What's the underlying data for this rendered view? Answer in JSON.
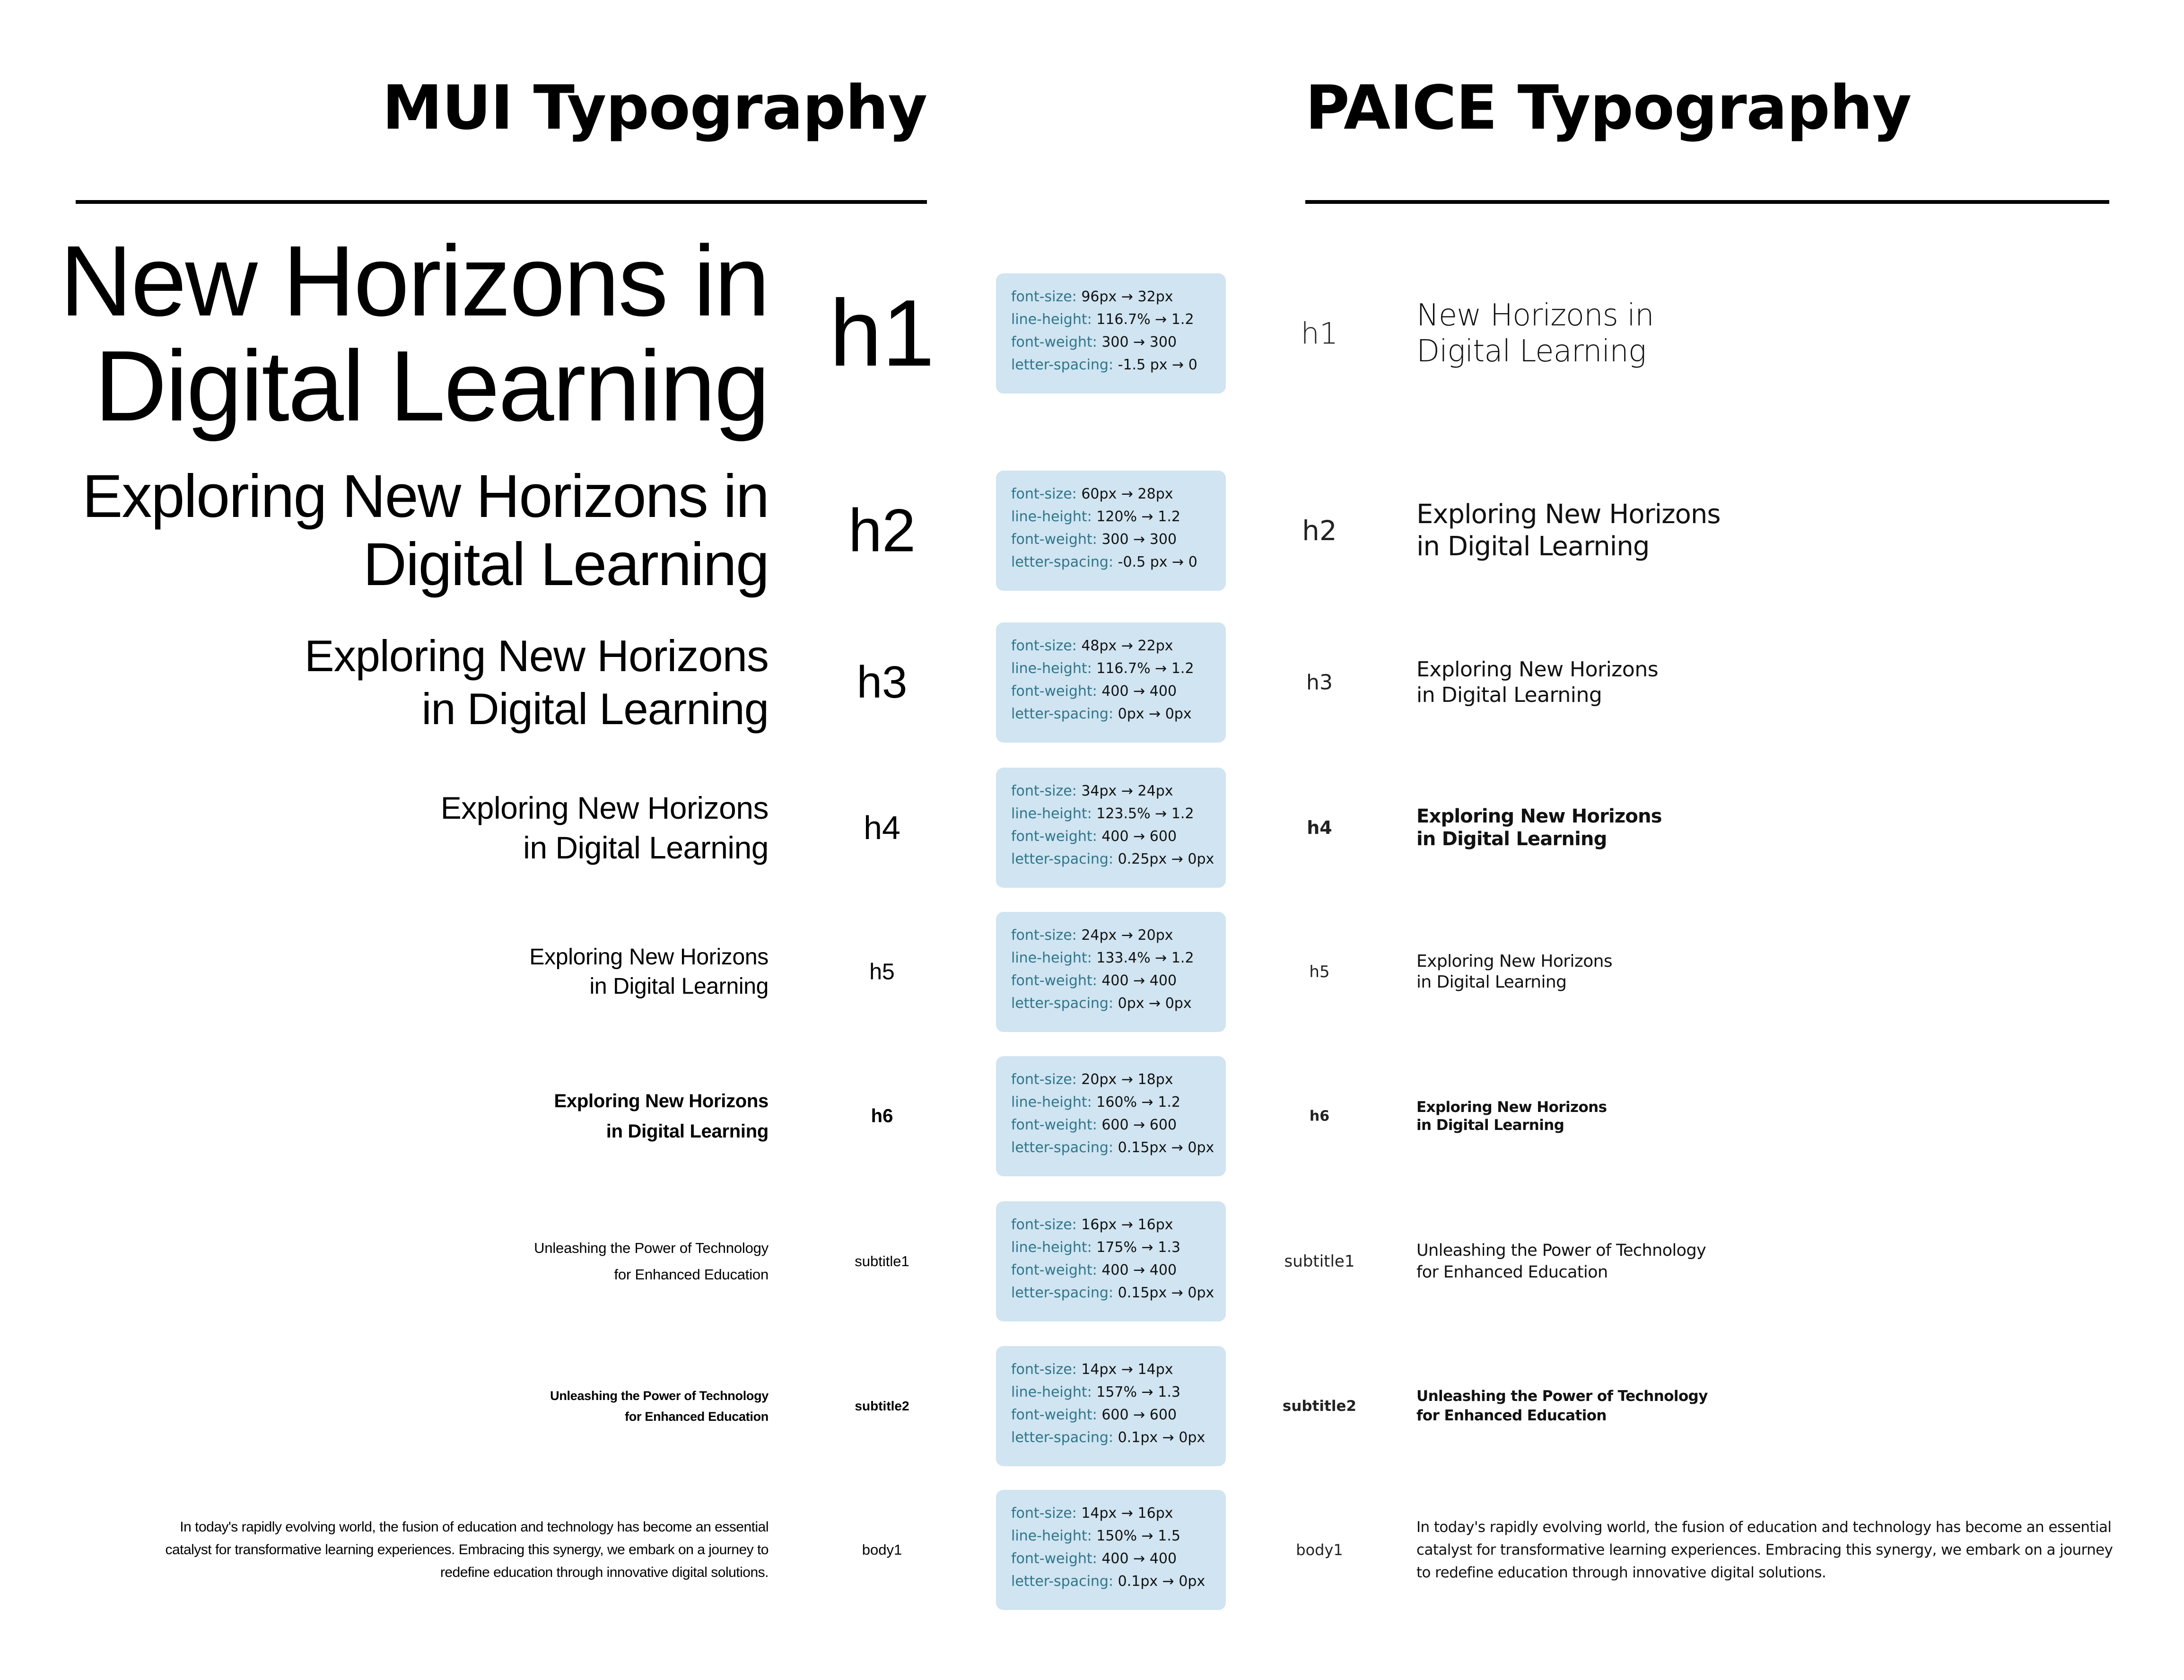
{
  "headers": {
    "mui_title": "MUI Typography",
    "paice_title": "PAICE Typography"
  },
  "colors": {
    "spec_box_background": "#d0e4f1",
    "spec_key_text": "#2f7589",
    "text": "#000000"
  },
  "rows": [
    {
      "variant": "h1",
      "mui_lines": [
        "New Horizons in",
        "Digital Learning"
      ],
      "paice_lines": [
        "New Horizons in",
        "Digital Learning"
      ],
      "spec": {
        "font_size": {
          "label": "font-size:",
          "value": "96px → 32px"
        },
        "line_height": {
          "label": "line-height:",
          "value": "116.7% → 1.2"
        },
        "font_weight": {
          "label": "font-weight:",
          "value": "300 → 300"
        },
        "letter_spacing": {
          "label": "letter-spacing:",
          "value": "-1.5 px → 0"
        }
      }
    },
    {
      "variant": "h2",
      "mui_lines": [
        "Exploring New Horizons in",
        "Digital Learning"
      ],
      "paice_lines": [
        "Exploring New Horizons",
        "in Digital Learning"
      ],
      "spec": {
        "font_size": {
          "label": "font-size:",
          "value": "60px → 28px"
        },
        "line_height": {
          "label": "line-height:",
          "value": "120% → 1.2"
        },
        "font_weight": {
          "label": "font-weight:",
          "value": "300 → 300"
        },
        "letter_spacing": {
          "label": "letter-spacing:",
          "value": "-0.5 px → 0"
        }
      }
    },
    {
      "variant": "h3",
      "mui_lines": [
        "Exploring New Horizons",
        "in Digital Learning"
      ],
      "paice_lines": [
        "Exploring New Horizons",
        "in Digital Learning"
      ],
      "spec": {
        "font_size": {
          "label": "font-size:",
          "value": "48px → 22px"
        },
        "line_height": {
          "label": "line-height:",
          "value": "116.7% → 1.2"
        },
        "font_weight": {
          "label": "font-weight:",
          "value": "400 → 400"
        },
        "letter_spacing": {
          "label": "letter-spacing:",
          "value": "0px → 0px"
        }
      }
    },
    {
      "variant": "h4",
      "mui_lines": [
        "Exploring New Horizons",
        "in Digital Learning"
      ],
      "paice_lines": [
        "Exploring New Horizons",
        "in Digital Learning"
      ],
      "spec": {
        "font_size": {
          "label": "font-size:",
          "value": "34px → 24px"
        },
        "line_height": {
          "label": "line-height:",
          "value": "123.5% → 1.2"
        },
        "font_weight": {
          "label": "font-weight:",
          "value": "400 → 600"
        },
        "letter_spacing": {
          "label": "letter-spacing:",
          "value": "0.25px → 0px"
        }
      }
    },
    {
      "variant": "h5",
      "mui_lines": [
        "Exploring New Horizons",
        "in Digital Learning"
      ],
      "paice_lines": [
        "Exploring New Horizons",
        "in Digital Learning"
      ],
      "spec": {
        "font_size": {
          "label": "font-size:",
          "value": "24px → 20px"
        },
        "line_height": {
          "label": "line-height:",
          "value": "133.4% → 1.2"
        },
        "font_weight": {
          "label": "font-weight:",
          "value": "400 → 400"
        },
        "letter_spacing": {
          "label": "letter-spacing:",
          "value": "0px → 0px"
        }
      }
    },
    {
      "variant": "h6",
      "mui_lines": [
        "Exploring New Horizons",
        "in Digital Learning"
      ],
      "paice_lines": [
        "Exploring New Horizons",
        "in Digital Learning"
      ],
      "spec": {
        "font_size": {
          "label": "font-size:",
          "value": "20px → 18px"
        },
        "line_height": {
          "label": "line-height:",
          "value": "160% → 1.2"
        },
        "font_weight": {
          "label": "font-weight:",
          "value": "600 → 600"
        },
        "letter_spacing": {
          "label": "letter-spacing:",
          "value": "0.15px → 0px"
        }
      }
    },
    {
      "variant": "subtitle1",
      "mui_lines": [
        "Unleashing the Power of Technology",
        "for Enhanced Education"
      ],
      "paice_lines": [
        "Unleashing the Power of Technology",
        "for Enhanced Education"
      ],
      "spec": {
        "font_size": {
          "label": "font-size:",
          "value": "16px → 16px"
        },
        "line_height": {
          "label": "line-height:",
          "value": "175% → 1.3"
        },
        "font_weight": {
          "label": "font-weight:",
          "value": "400 → 400"
        },
        "letter_spacing": {
          "label": "letter-spacing:",
          "value": "0.15px → 0px"
        }
      }
    },
    {
      "variant": "subtitle2",
      "mui_lines": [
        "Unleashing the Power of Technology",
        "for Enhanced Education"
      ],
      "paice_lines": [
        "Unleashing the Power of Technology",
        "for Enhanced Education"
      ],
      "spec": {
        "font_size": {
          "label": "font-size:",
          "value": "14px → 14px"
        },
        "line_height": {
          "label": "line-height:",
          "value": "157% → 1.3"
        },
        "font_weight": {
          "label": "font-weight:",
          "value": "600 → 600"
        },
        "letter_spacing": {
          "label": "letter-spacing:",
          "value": "0.1px → 0px"
        }
      }
    },
    {
      "variant": "body1",
      "mui_lines": [
        "In today's rapidly evolving world, the fusion of education and technology has become an essential",
        "catalyst for transformative learning experiences. Embracing this synergy, we embark on a journey to",
        "redefine education through innovative digital solutions."
      ],
      "paice_lines": [
        "In today's rapidly evolving world, the fusion of education and technology has become an essential",
        "catalyst for transformative learning experiences. Embracing this synergy, we embark on a journey",
        "to redefine education through innovative digital solutions."
      ],
      "spec": {
        "font_size": {
          "label": "font-size:",
          "value": "14px → 16px"
        },
        "line_height": {
          "label": "line-height:",
          "value": "150% → 1.5"
        },
        "font_weight": {
          "label": "font-weight:",
          "value": "400 → 400"
        },
        "letter_spacing": {
          "label": "letter-spacing:",
          "value": "0.1px → 0px"
        }
      }
    }
  ]
}
